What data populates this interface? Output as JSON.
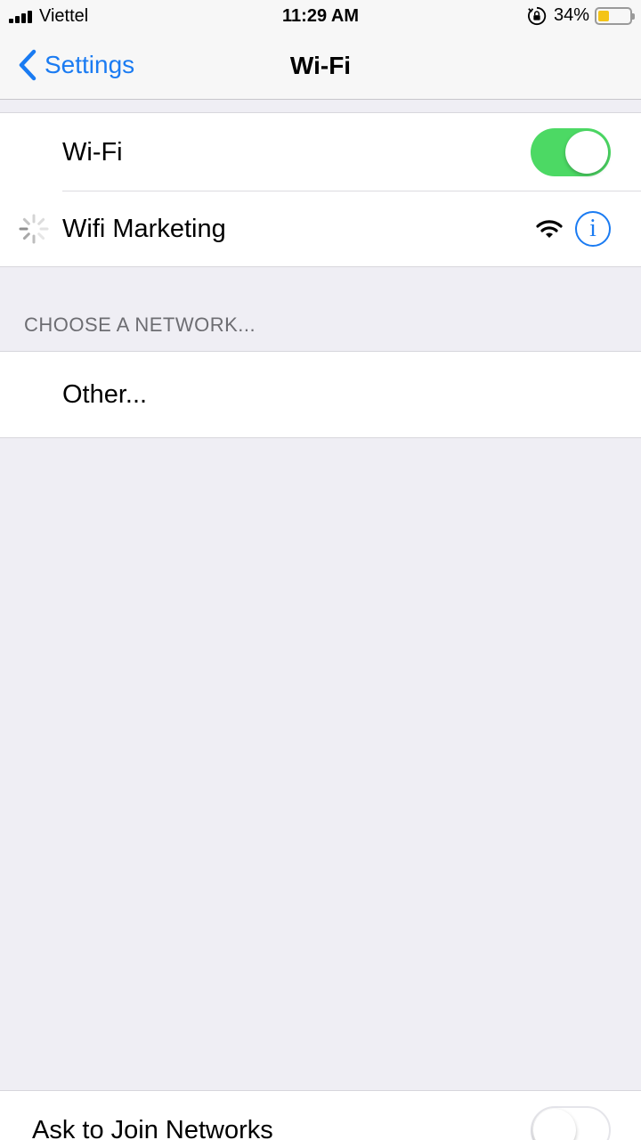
{
  "status_bar": {
    "carrier": "Viettel",
    "time": "11:29 AM",
    "battery_percent_text": "34%",
    "battery_level": 0.34,
    "battery_color": "#f4c418"
  },
  "nav": {
    "back_label": "Settings",
    "title": "Wi-Fi"
  },
  "wifi_toggle": {
    "label": "Wi-Fi",
    "on": true,
    "on_color": "#4cd964"
  },
  "current_network": {
    "name": "Wifi Marketing",
    "icons": [
      "loading-spinner-icon",
      "wifi-signal-icon",
      "info-icon"
    ],
    "info_glyph": "i"
  },
  "choose_network": {
    "header": "CHOOSE A NETWORK...",
    "other_label": "Other..."
  },
  "ask_to_join": {
    "label": "Ask to Join Networks",
    "on": false
  },
  "accent_color": "#1a7bf2"
}
